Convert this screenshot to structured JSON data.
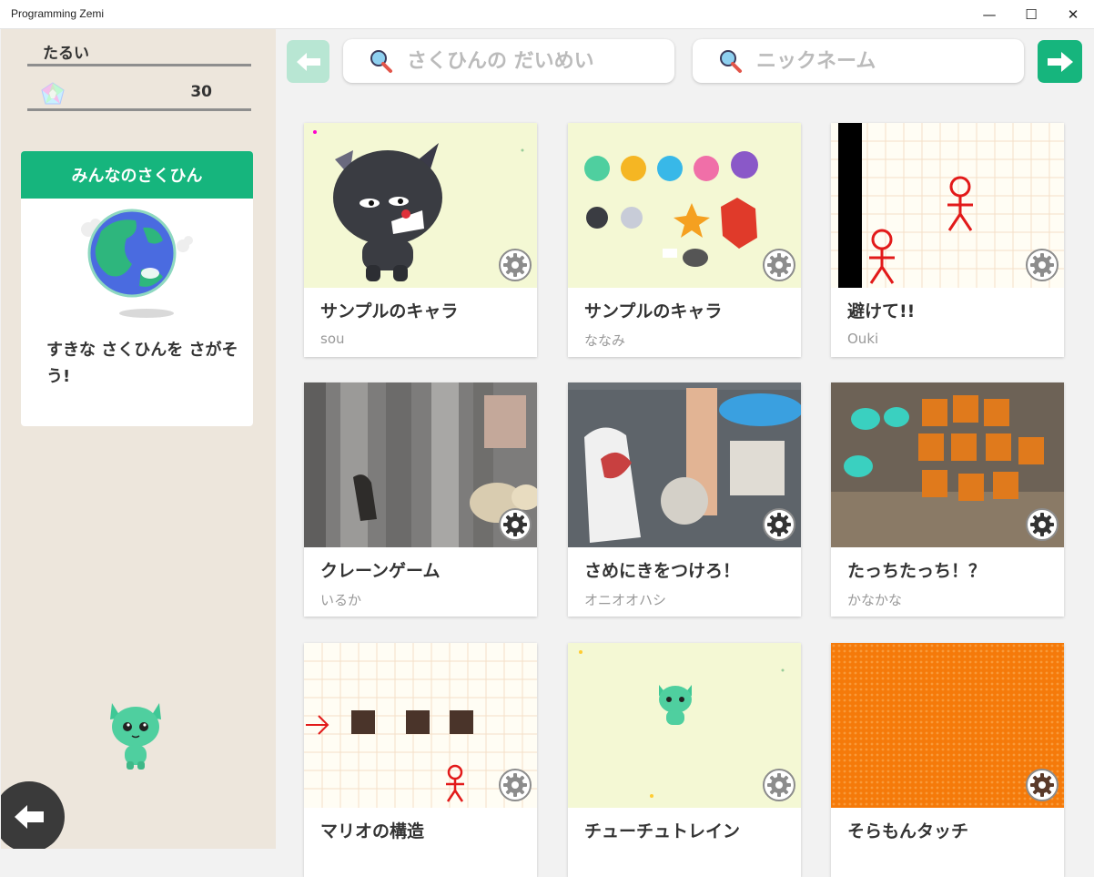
{
  "window": {
    "title": "Programming Zemi",
    "minimize": "—",
    "maximize": "☐",
    "close": "✕"
  },
  "sidebar": {
    "user_name": "たるい",
    "points": "30",
    "featured": {
      "header": "みんなのさくひん",
      "message": "すきな さくひんを さがそう!"
    }
  },
  "search": {
    "title_placeholder": "さくひんの だいめい",
    "nickname_placeholder": "ニックネーム"
  },
  "works": [
    {
      "title": "サンプルのキャラ",
      "author": "sou"
    },
    {
      "title": "サンプルのキャラ",
      "author": "ななみ"
    },
    {
      "title": "避けて!!",
      "author": "Ouki"
    },
    {
      "title": "クレーンゲーム",
      "author": "いるか"
    },
    {
      "title": "さめにきをつけろ！",
      "author": "オニオオハシ"
    },
    {
      "title": "たっちたっち！？",
      "author": "かなかな"
    },
    {
      "title": "マリオの構造",
      "author": ""
    },
    {
      "title": "チューチュトレイン",
      "author": ""
    },
    {
      "title": "そらもんタッチ",
      "author": ""
    }
  ],
  "colors": {
    "accent": "#16b57d",
    "sidebar_bg": "#ede6dc"
  }
}
